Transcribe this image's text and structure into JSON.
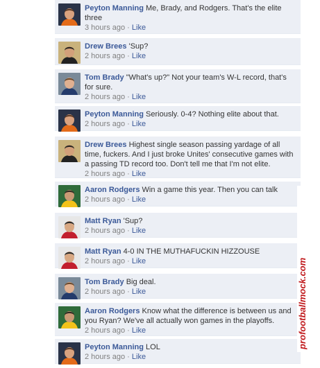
{
  "comments": [
    {
      "author": "Peyton Manning",
      "text": "Me, Brady, and Rodgers. That's the elite three",
      "time": "3 hours ago",
      "like": "Like",
      "avatar": "peyton-manning-avatar"
    },
    {
      "author": "Drew Brees",
      "text": "'Sup?",
      "time": "2 hours ago",
      "like": "Like",
      "avatar": "drew-brees-avatar"
    },
    {
      "author": "Tom Brady",
      "text": "\"What's up?\" Not your team's W-L record, that's for sure.",
      "time": "2 hours ago",
      "like": "Like",
      "avatar": "tom-brady-avatar"
    },
    {
      "author": "Peyton Manning",
      "text": "Seriously. 0-4? Nothing elite about that.",
      "time": "2 hours ago",
      "like": "Like",
      "avatar": "peyton-manning-avatar"
    },
    {
      "author": "Drew Brees",
      "text": "Highest single season passing yardage of all time, fuckers. And I just broke Unites' consecutive games with a passing TD record too. Don't tell me that I'm not elite.",
      "time": "2 hours ago",
      "like": "Like",
      "avatar": "drew-brees-avatar"
    },
    {
      "author": "Aaron Rodgers",
      "text": "Win a game this year. Then you can talk",
      "time": "2 hours ago",
      "like": "Like",
      "avatar": "aaron-rodgers-avatar"
    },
    {
      "author": "Matt Ryan",
      "text": "'Sup?",
      "time": "2 hours ago",
      "like": "Like",
      "avatar": "matt-ryan-avatar"
    },
    {
      "author": "Matt Ryan",
      "text": "4-0 IN THE MUTHAFUCKIN HIZZOUSE",
      "time": "2 hours ago",
      "like": "Like",
      "avatar": "matt-ryan-avatar"
    },
    {
      "author": "Tom Brady",
      "text": "Big deal.",
      "time": "2 hours ago",
      "like": "Like",
      "avatar": "tom-brady-avatar"
    },
    {
      "author": "Aaron Rodgers",
      "text": "Know what the difference is between us and you Ryan? We've all actually won games in the playoffs.",
      "time": "2 hours ago",
      "like": "Like",
      "avatar": "aaron-rodgers-avatar"
    },
    {
      "author": "Peyton Manning",
      "text": "LOL",
      "time": "2 hours ago",
      "like": "Like",
      "avatar": "peyton-manning-avatar"
    }
  ],
  "separator": "·",
  "watermark": {
    "text": "profootballmock.com"
  },
  "colors": {
    "link": "#3b5998",
    "background": "#eceff5",
    "meta": "#808080",
    "watermark": "#c0191c"
  }
}
